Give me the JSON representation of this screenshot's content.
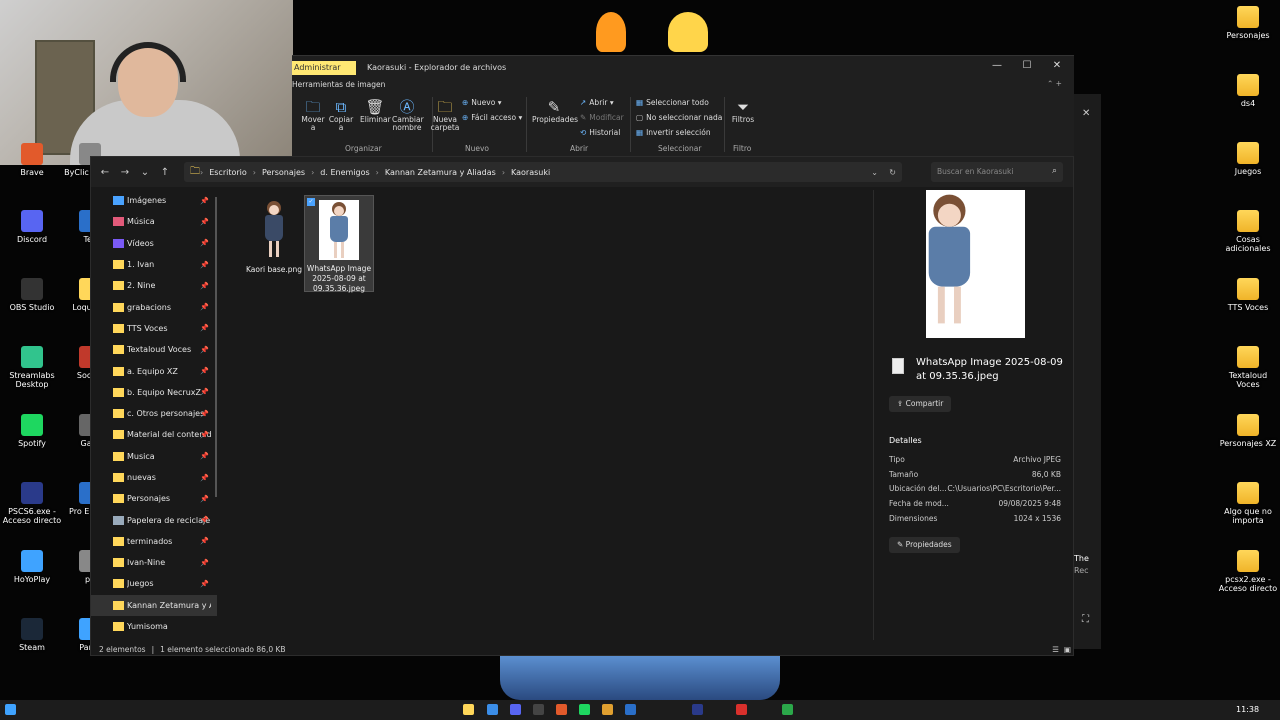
{
  "desktop_left": [
    {
      "label": "Brave"
    },
    {
      "label": "Discord"
    },
    {
      "label": "OBS Studio"
    },
    {
      "label": "Streamlabs Desktop"
    },
    {
      "label": "Spotify"
    },
    {
      "label": "PSCS6.exe - Acceso directo"
    },
    {
      "label": "HoYoPlay"
    },
    {
      "label": "Steam"
    }
  ],
  "desktop_left2": [
    {
      "label": "ByClic - Acce"
    },
    {
      "label": "Tex"
    },
    {
      "label": "Loque Di"
    },
    {
      "label": "Soc Es"
    },
    {
      "label": "Gam"
    },
    {
      "label": "Pro E Acce"
    },
    {
      "label": "pT"
    },
    {
      "label": "Panel"
    }
  ],
  "desktop_right": [
    {
      "label": "Personajes"
    },
    {
      "label": "ds4"
    },
    {
      "label": "Juegos"
    },
    {
      "label": "Cosas adicionales"
    },
    {
      "label": "TTS Voces"
    },
    {
      "label": "Textaloud Voces"
    },
    {
      "label": "Personajes XZ"
    },
    {
      "label": "Algo que no importa"
    },
    {
      "label": "pcsx2.exe - Acceso directo"
    }
  ],
  "window": {
    "admin_tab": "Administrar",
    "context_tab": "Herramientas de imagen",
    "title": "Kaorasuki - Explorador de archivos"
  },
  "ribbon": {
    "mover": "Mover a",
    "copiar": "Copiar a",
    "eliminar": "Eliminar",
    "cambiar": "Cambiar nombre",
    "nueva": "Nueva carpeta",
    "nuevo": "Nuevo",
    "facil": "Fácil acceso",
    "propiedades": "Propiedades",
    "abrir": "Abrir",
    "modificar": "Modificar",
    "historial": "Historial",
    "sel_todo": "Seleccionar todo",
    "sel_nada": "No seleccionar nada",
    "invertir": "Invertir selección",
    "filtros": "Filtros",
    "group_organizar": "Organizar",
    "group_nuevo": "Nuevo",
    "group_abrir": "Abrir",
    "group_seleccionar": "Seleccionar",
    "group_filtro": "Filtro"
  },
  "address": {
    "crumbs": [
      "Escritorio",
      "Personajes",
      "d. Enemigos",
      "Kannan Zetamura y Aliadas",
      "Kaorasuki"
    ],
    "search_placeholder": "Buscar en Kaorasuki"
  },
  "nav": [
    {
      "label": "Imágenes"
    },
    {
      "label": "Música"
    },
    {
      "label": "Vídeos"
    },
    {
      "label": "1. Ivan"
    },
    {
      "label": "2. Nine"
    },
    {
      "label": "grabacions"
    },
    {
      "label": "TTS Voces"
    },
    {
      "label": "Textaloud Voces"
    },
    {
      "label": "a. Equipo XZ"
    },
    {
      "label": "b. Equipo NecruxZ"
    },
    {
      "label": "c. Otros personajes"
    },
    {
      "label": "Material del contenido"
    },
    {
      "label": "Musica"
    },
    {
      "label": "nuevas"
    },
    {
      "label": "Personajes"
    },
    {
      "label": "Papelera de reciclaje"
    },
    {
      "label": "terminados"
    },
    {
      "label": "Ivan-Nine"
    },
    {
      "label": "Juegos"
    },
    {
      "label": "Kannan Zetamura y Aliadas"
    },
    {
      "label": "Yumisoma"
    }
  ],
  "files": [
    {
      "name": "Kaori base.png"
    },
    {
      "name": "WhatsApp Image 2025-08-09 at 09.35.36.jpeg"
    }
  ],
  "preview": {
    "filename": "WhatsApp Image 2025-08-09 at 09.35.36.jpeg",
    "share": "Compartir",
    "details_title": "Detalles",
    "details": [
      {
        "k": "Tipo",
        "v": "Archivo JPEG"
      },
      {
        "k": "Tamaño",
        "v": "86,0 KB"
      },
      {
        "k": "Ubicación del...",
        "v": "C:\\Usuarios\\PC\\Escritorio\\Per..."
      },
      {
        "k": "Fecha de mod...",
        "v": "09/08/2025 9:48"
      },
      {
        "k": "Dimensiones",
        "v": "1024 x 1536"
      }
    ],
    "props_btn": "Propiedades"
  },
  "status": {
    "count": "2 elementos",
    "selected": "1 elemento seleccionado  86,0 KB"
  },
  "taskbar": {
    "time": "11:38"
  },
  "side_text": {
    "the": "The",
    "rec": "Rec"
  }
}
